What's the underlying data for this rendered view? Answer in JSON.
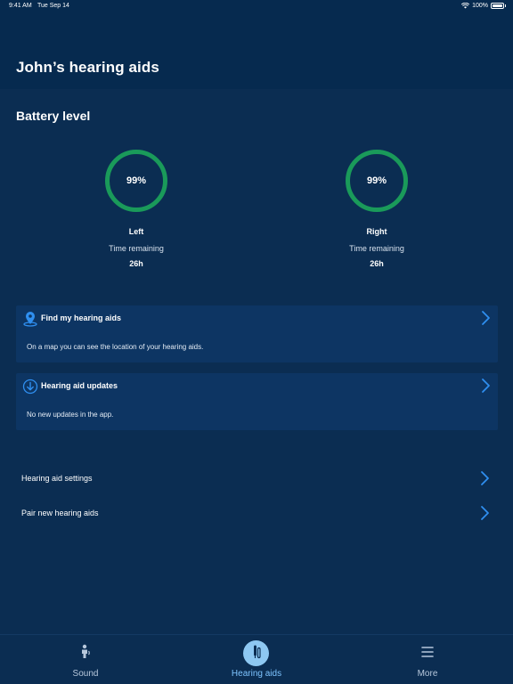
{
  "status_bar": {
    "time": "9:41 AM",
    "date": "Tue Sep 14",
    "battery": "100%"
  },
  "header": {
    "title": "John’s hearing aids"
  },
  "battery": {
    "section_title": "Battery level",
    "left": {
      "percent": "99%",
      "side": "Left",
      "time_label": "Time remaining",
      "time_value": "26h"
    },
    "right": {
      "percent": "99%",
      "side": "Right",
      "time_label": "Time remaining",
      "time_value": "26h"
    },
    "ring_color": "#1a9a5a"
  },
  "cards": {
    "find": {
      "title": "Find my hearing aids",
      "description": "On a map you can see the location of your hearing aids.",
      "icon": "location-pin-icon"
    },
    "updates": {
      "title": "Hearing aid updates",
      "description": "No new updates in the app.",
      "icon": "download-circle-icon"
    }
  },
  "list": {
    "settings_label": "Hearing aid settings",
    "pair_label": "Pair new hearing aids"
  },
  "tabs": [
    {
      "label": "Sound",
      "icon": "sound-icon",
      "active": false
    },
    {
      "label": "Hearing aids",
      "icon": "hearing-aids-icon",
      "active": true
    },
    {
      "label": "More",
      "icon": "menu-icon",
      "active": false
    }
  ],
  "colors": {
    "background": "#062a4f",
    "card": "#0d3563",
    "accent": "#2f8ff0",
    "battery_ring": "#1a9a5a"
  }
}
